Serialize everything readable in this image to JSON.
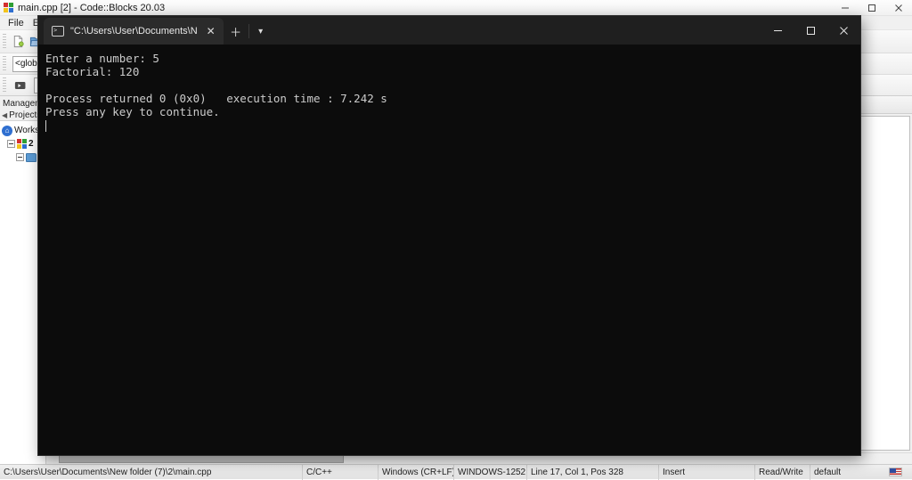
{
  "codeblocks": {
    "title": "main.cpp [2] - Code::Blocks 20.03",
    "app_icon": "codeblocks-logo-icon",
    "window_controls": {
      "minimize": "minimize-icon",
      "maximize": "maximize-icon",
      "close": "close-icon"
    },
    "menu": [
      {
        "label": "File"
      },
      {
        "label": "Edit"
      }
    ],
    "toolbar": {
      "new_file_icon": "new-file-icon",
      "open_file_icon": "open-file-icon",
      "scope_combo_value": "<global>",
      "debug_icon": "debug-continue-icon"
    },
    "management": {
      "title": "Management",
      "tab_arrow": "◀",
      "tabs": [
        {
          "label": "Projects"
        }
      ],
      "tree": [
        {
          "label": "Workspace",
          "icon": "workspace-home-icon",
          "level": 1
        },
        {
          "label": "2",
          "icon": "project-icon",
          "level": 2
        },
        {
          "label": "",
          "icon": "folder-icon",
          "level": 3
        }
      ]
    },
    "statusbar": {
      "file_path": "C:\\Users\\User\\Documents\\New folder (7)\\2\\main.cpp",
      "language": "C/C++",
      "line_endings": "Windows (CR+LF)",
      "encoding": "WINDOWS-1252",
      "caret": "Line 17, Col 1, Pos 328",
      "insert_mode": "Insert",
      "access_mode": "Read/Write",
      "profile": "default",
      "language_flag": "us-flag-icon"
    }
  },
  "terminal": {
    "tab": {
      "icon": "console-icon",
      "title": "\"C:\\Users\\User\\Documents\\N",
      "close_icon": "close-icon"
    },
    "new_tab_icon": "plus-icon",
    "dropdown_icon": "chevron-down-icon",
    "window_controls": {
      "minimize": "minimize-icon",
      "maximize": "maximize-icon",
      "close": "close-icon"
    },
    "output_lines": [
      "Enter a number: 5",
      "Factorial: 120",
      "",
      "Process returned 0 (0x0)   execution time : 7.242 s",
      "Press any key to continue."
    ],
    "output_text": "Enter a number: 5\nFactorial: 120\n\nProcess returned 0 (0x0)   execution time : 7.242 s\nPress any key to continue.\n"
  },
  "colors": {
    "terminal_bg": "#0c0c0c",
    "terminal_fg": "#cccccc",
    "terminal_chrome": "#1f1f1f",
    "tab_active": "#2b2b2b",
    "window_chrome": "#f0f0f0"
  }
}
